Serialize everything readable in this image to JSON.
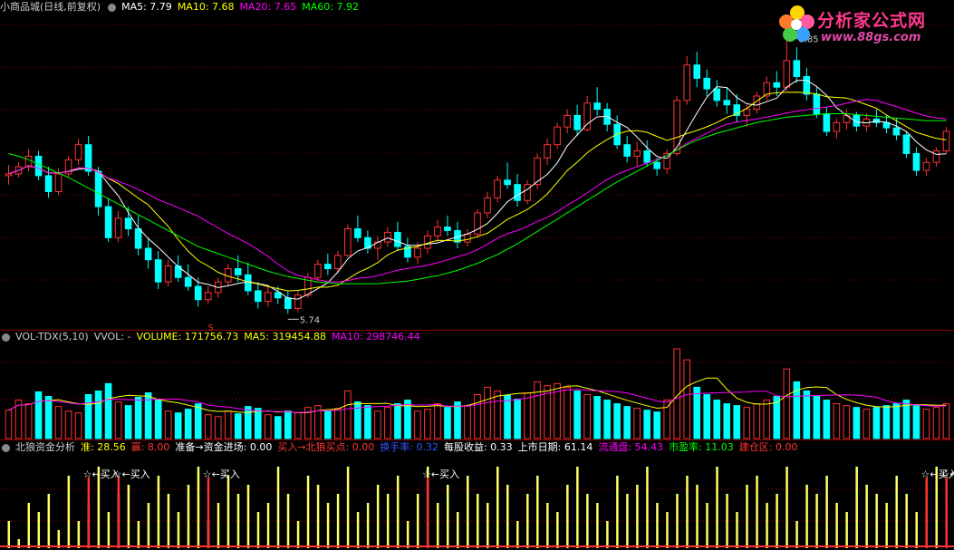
{
  "price_panel": {
    "title": "小商品城(日线,前复权)",
    "ma": [
      {
        "label": "MA5: 7.79",
        "color": "#ffffff"
      },
      {
        "label": "MA10: 7.68",
        "color": "#ffff00"
      },
      {
        "label": "MA20: 7.65",
        "color": "#ff00ff"
      },
      {
        "label": "MA60: 7.92",
        "color": "#00ff00"
      }
    ],
    "high_label": "8.85",
    "low_label": "5.74",
    "signal_mark": "S"
  },
  "volume_panel": {
    "items": [
      {
        "label": "VOL-TDX(5,10)",
        "color": "#cccccc"
      },
      {
        "label": "VVOL: -",
        "color": "#cccccc"
      },
      {
        "label": "VOLUME: 171756.73",
        "color": "#ffff00"
      },
      {
        "label": "MA5: 319454.88",
        "color": "#ffff00"
      },
      {
        "label": "MA10: 298746.44",
        "color": "#ff00ff"
      }
    ]
  },
  "indicator_panel": {
    "items": [
      {
        "label": "北狼资金分析",
        "color": "#cccccc"
      },
      {
        "label": "准: 28.56",
        "color": "#ffff00"
      },
      {
        "label": "赢: 8.00",
        "color": "#ff3333"
      },
      {
        "label": "准备→资金进场: 0.00",
        "color": "#ffffff"
      },
      {
        "label": "买入→北狼买点: 0.00",
        "color": "#ff3333"
      },
      {
        "label": "换手率: 0.32",
        "color": "#3355ff"
      },
      {
        "label": "每股收益: 0.33",
        "color": "#ffffff"
      },
      {
        "label": "上市日期: 61.14",
        "color": "#ffffff"
      },
      {
        "label": "流通盘: 54.43",
        "color": "#ff00ff"
      },
      {
        "label": "市盈率: 11.03",
        "color": "#00ff00"
      },
      {
        "label": "建仓区: 0.00",
        "color": "#ff3333"
      }
    ],
    "buy_labels": [
      "☆←买入",
      "☆←买入",
      "☆←买入",
      "☆←买入",
      "☆←买入",
      "☆←买入"
    ]
  },
  "watermark": {
    "title": "分析家公式网",
    "url": "www.88gs.com"
  },
  "colors": {
    "up": "#ff3333",
    "down": "#00ffff",
    "ma5": "#ffffff",
    "ma10": "#ffff00",
    "ma20": "#ff00ff",
    "ma60": "#00ff00",
    "grid": "#8b0000",
    "indicator_bar": "#ffff66",
    "indicator_red": "#ff3333"
  },
  "chart_data": {
    "type": "candlestick",
    "price_range": [
      5.6,
      9.1
    ],
    "candles": [
      [
        7.3,
        7.42,
        7.2,
        7.32
      ],
      [
        7.32,
        7.45,
        7.28,
        7.4
      ],
      [
        7.4,
        7.6,
        7.35,
        7.52
      ],
      [
        7.52,
        7.58,
        7.25,
        7.3
      ],
      [
        7.3,
        7.4,
        7.05,
        7.12
      ],
      [
        7.12,
        7.38,
        7.08,
        7.32
      ],
      [
        7.32,
        7.52,
        7.28,
        7.48
      ],
      [
        7.48,
        7.72,
        7.42,
        7.65
      ],
      [
        7.65,
        7.75,
        7.3,
        7.35
      ],
      [
        7.35,
        7.4,
        6.85,
        6.95
      ],
      [
        6.95,
        7.05,
        6.55,
        6.6
      ],
      [
        6.6,
        6.9,
        6.55,
        6.82
      ],
      [
        6.82,
        6.95,
        6.62,
        6.7
      ],
      [
        6.7,
        6.85,
        6.4,
        6.48
      ],
      [
        6.48,
        6.6,
        6.25,
        6.35
      ],
      [
        6.35,
        6.45,
        6.02,
        6.1
      ],
      [
        6.1,
        6.35,
        6.05,
        6.28
      ],
      [
        6.28,
        6.4,
        6.1,
        6.15
      ],
      [
        6.15,
        6.3,
        6.0,
        6.05
      ],
      [
        6.05,
        6.15,
        5.82,
        5.9
      ],
      [
        5.9,
        6.05,
        5.85,
        5.98
      ],
      [
        5.98,
        6.15,
        5.92,
        6.1
      ],
      [
        6.1,
        6.3,
        6.05,
        6.25
      ],
      [
        6.25,
        6.4,
        6.1,
        6.18
      ],
      [
        6.18,
        6.32,
        5.95,
        6.0
      ],
      [
        6.0,
        6.1,
        5.8,
        5.88
      ],
      [
        5.88,
        6.05,
        5.82,
        5.98
      ],
      [
        5.98,
        6.05,
        5.85,
        5.92
      ],
      [
        5.92,
        6.0,
        5.74,
        5.8
      ],
      [
        5.8,
        6.0,
        5.76,
        5.95
      ],
      [
        5.95,
        6.2,
        5.92,
        6.15
      ],
      [
        6.15,
        6.35,
        6.1,
        6.3
      ],
      [
        6.3,
        6.42,
        6.18,
        6.25
      ],
      [
        6.25,
        6.45,
        6.2,
        6.4
      ],
      [
        6.4,
        6.75,
        6.38,
        6.7
      ],
      [
        6.7,
        6.85,
        6.55,
        6.6
      ],
      [
        6.6,
        6.68,
        6.42,
        6.48
      ],
      [
        6.48,
        6.62,
        6.35,
        6.55
      ],
      [
        6.55,
        6.72,
        6.5,
        6.66
      ],
      [
        6.66,
        6.78,
        6.45,
        6.5
      ],
      [
        6.5,
        6.6,
        6.32,
        6.38
      ],
      [
        6.38,
        6.55,
        6.3,
        6.48
      ],
      [
        6.48,
        6.68,
        6.42,
        6.62
      ],
      [
        6.62,
        6.8,
        6.55,
        6.72
      ],
      [
        6.72,
        6.85,
        6.62,
        6.68
      ],
      [
        6.68,
        6.78,
        6.48,
        6.55
      ],
      [
        6.55,
        6.7,
        6.5,
        6.64
      ],
      [
        6.64,
        6.92,
        6.6,
        6.88
      ],
      [
        6.88,
        7.12,
        6.82,
        7.05
      ],
      [
        7.05,
        7.3,
        7.0,
        7.25
      ],
      [
        7.25,
        7.45,
        7.15,
        7.2
      ],
      [
        7.2,
        7.32,
        6.95,
        7.02
      ],
      [
        7.02,
        7.25,
        6.98,
        7.2
      ],
      [
        7.2,
        7.55,
        7.15,
        7.5
      ],
      [
        7.5,
        7.72,
        7.42,
        7.65
      ],
      [
        7.65,
        7.9,
        7.6,
        7.85
      ],
      [
        7.85,
        8.05,
        7.78,
        7.98
      ],
      [
        7.98,
        8.1,
        7.75,
        7.82
      ],
      [
        7.82,
        8.2,
        7.8,
        8.12
      ],
      [
        8.12,
        8.3,
        7.98,
        8.05
      ],
      [
        8.05,
        8.12,
        7.8,
        7.88
      ],
      [
        7.88,
        7.98,
        7.6,
        7.65
      ],
      [
        7.65,
        7.75,
        7.45,
        7.52
      ],
      [
        7.52,
        7.68,
        7.4,
        7.58
      ],
      [
        7.58,
        7.7,
        7.4,
        7.45
      ],
      [
        7.45,
        7.5,
        7.3,
        7.38
      ],
      [
        7.38,
        7.6,
        7.32,
        7.55
      ],
      [
        7.55,
        8.2,
        7.52,
        8.15
      ],
      [
        8.15,
        8.65,
        8.1,
        8.55
      ],
      [
        8.55,
        8.7,
        8.3,
        8.4
      ],
      [
        8.4,
        8.5,
        8.2,
        8.28
      ],
      [
        8.28,
        8.38,
        8.08,
        8.15
      ],
      [
        8.15,
        8.3,
        8.0,
        8.1
      ],
      [
        8.1,
        8.22,
        7.9,
        7.98
      ],
      [
        7.98,
        8.1,
        7.85,
        8.05
      ],
      [
        8.05,
        8.25,
        8.0,
        8.2
      ],
      [
        8.2,
        8.42,
        8.15,
        8.35
      ],
      [
        8.35,
        8.48,
        8.2,
        8.3
      ],
      [
        8.3,
        8.85,
        8.25,
        8.6
      ],
      [
        8.6,
        8.75,
        8.35,
        8.42
      ],
      [
        8.42,
        8.52,
        8.15,
        8.22
      ],
      [
        8.22,
        8.3,
        7.95,
        8.0
      ],
      [
        8.0,
        8.08,
        7.75,
        7.8
      ],
      [
        7.8,
        7.95,
        7.72,
        7.9
      ],
      [
        7.9,
        8.05,
        7.82,
        7.98
      ],
      [
        7.98,
        8.02,
        7.8,
        7.86
      ],
      [
        7.86,
        8.0,
        7.8,
        7.94
      ],
      [
        7.94,
        8.05,
        7.85,
        7.9
      ],
      [
        7.9,
        7.98,
        7.78,
        7.84
      ],
      [
        7.84,
        7.95,
        7.7,
        7.76
      ],
      [
        7.76,
        7.8,
        7.5,
        7.55
      ],
      [
        7.55,
        7.62,
        7.3,
        7.36
      ],
      [
        7.36,
        7.5,
        7.3,
        7.45
      ],
      [
        7.45,
        7.62,
        7.4,
        7.58
      ],
      [
        7.58,
        7.85,
        7.55,
        7.8
      ]
    ],
    "ma60": [
      7.55,
      7.52,
      7.48,
      7.43,
      7.38,
      7.33,
      7.28,
      7.22,
      7.16,
      7.1,
      7.04,
      6.98,
      6.92,
      6.86,
      6.8,
      6.74,
      6.68,
      6.62,
      6.56,
      6.5,
      6.46,
      6.42,
      6.38,
      6.34,
      6.3,
      6.26,
      6.22,
      6.19,
      6.16,
      6.14,
      6.12,
      6.1,
      6.09,
      6.08,
      6.08,
      6.08,
      6.08,
      6.08,
      6.09,
      6.1,
      6.11,
      6.13,
      6.15,
      6.17,
      6.2,
      6.23,
      6.27,
      6.31,
      6.36,
      6.41,
      6.47,
      6.53,
      6.6,
      6.67,
      6.74,
      6.81,
      6.88,
      6.95,
      7.02,
      7.09,
      7.16,
      7.23,
      7.29,
      7.35,
      7.41,
      7.47,
      7.53,
      7.59,
      7.65,
      7.7,
      7.74,
      7.78,
      7.81,
      7.84,
      7.87,
      7.9,
      7.92,
      7.94,
      7.96,
      7.97,
      7.98,
      7.99,
      8.0,
      8.0,
      8.0,
      7.99,
      7.98,
      7.97,
      7.96,
      7.95,
      7.94,
      7.93,
      7.92,
      7.92,
      7.92
    ],
    "volume": [
      310,
      420,
      380,
      510,
      460,
      350,
      300,
      280,
      480,
      520,
      600,
      400,
      360,
      450,
      500,
      420,
      300,
      280,
      320,
      380,
      260,
      240,
      300,
      270,
      350,
      330,
      260,
      240,
      300,
      280,
      340,
      360,
      300,
      330,
      520,
      400,
      360,
      300,
      340,
      380,
      420,
      300,
      320,
      380,
      340,
      400,
      360,
      480,
      560,
      520,
      470,
      430,
      500,
      620,
      580,
      600,
      560,
      520,
      480,
      460,
      420,
      380,
      350,
      330,
      310,
      290,
      420,
      980,
      860,
      560,
      480,
      420,
      380,
      360,
      340,
      380,
      420,
      460,
      760,
      620,
      520,
      460,
      420,
      380,
      360,
      340,
      320,
      340,
      360,
      380,
      420,
      360,
      320,
      340,
      380
    ],
    "indicator": [
      3,
      1,
      5,
      4,
      6,
      2,
      8,
      3,
      5,
      9,
      4,
      6,
      7,
      3,
      5,
      8,
      6,
      4,
      7,
      9,
      3,
      5,
      8,
      6,
      7,
      4,
      5,
      9,
      6,
      3,
      8,
      7,
      5,
      6,
      9,
      4,
      5,
      7,
      6,
      8,
      3,
      6,
      9,
      5,
      7,
      4,
      8,
      6,
      5,
      9,
      7,
      3,
      6,
      8,
      5,
      4,
      7,
      9,
      6,
      5,
      3,
      8,
      6,
      7,
      9,
      5,
      4,
      6,
      8,
      7,
      5,
      9,
      6,
      4,
      7,
      8,
      5,
      6,
      9,
      3,
      7,
      6,
      8,
      5,
      4,
      9,
      7,
      6,
      5,
      8,
      6,
      4,
      7,
      9,
      5
    ],
    "buy_signal_index": [
      8,
      11,
      20,
      42,
      92,
      94
    ]
  }
}
